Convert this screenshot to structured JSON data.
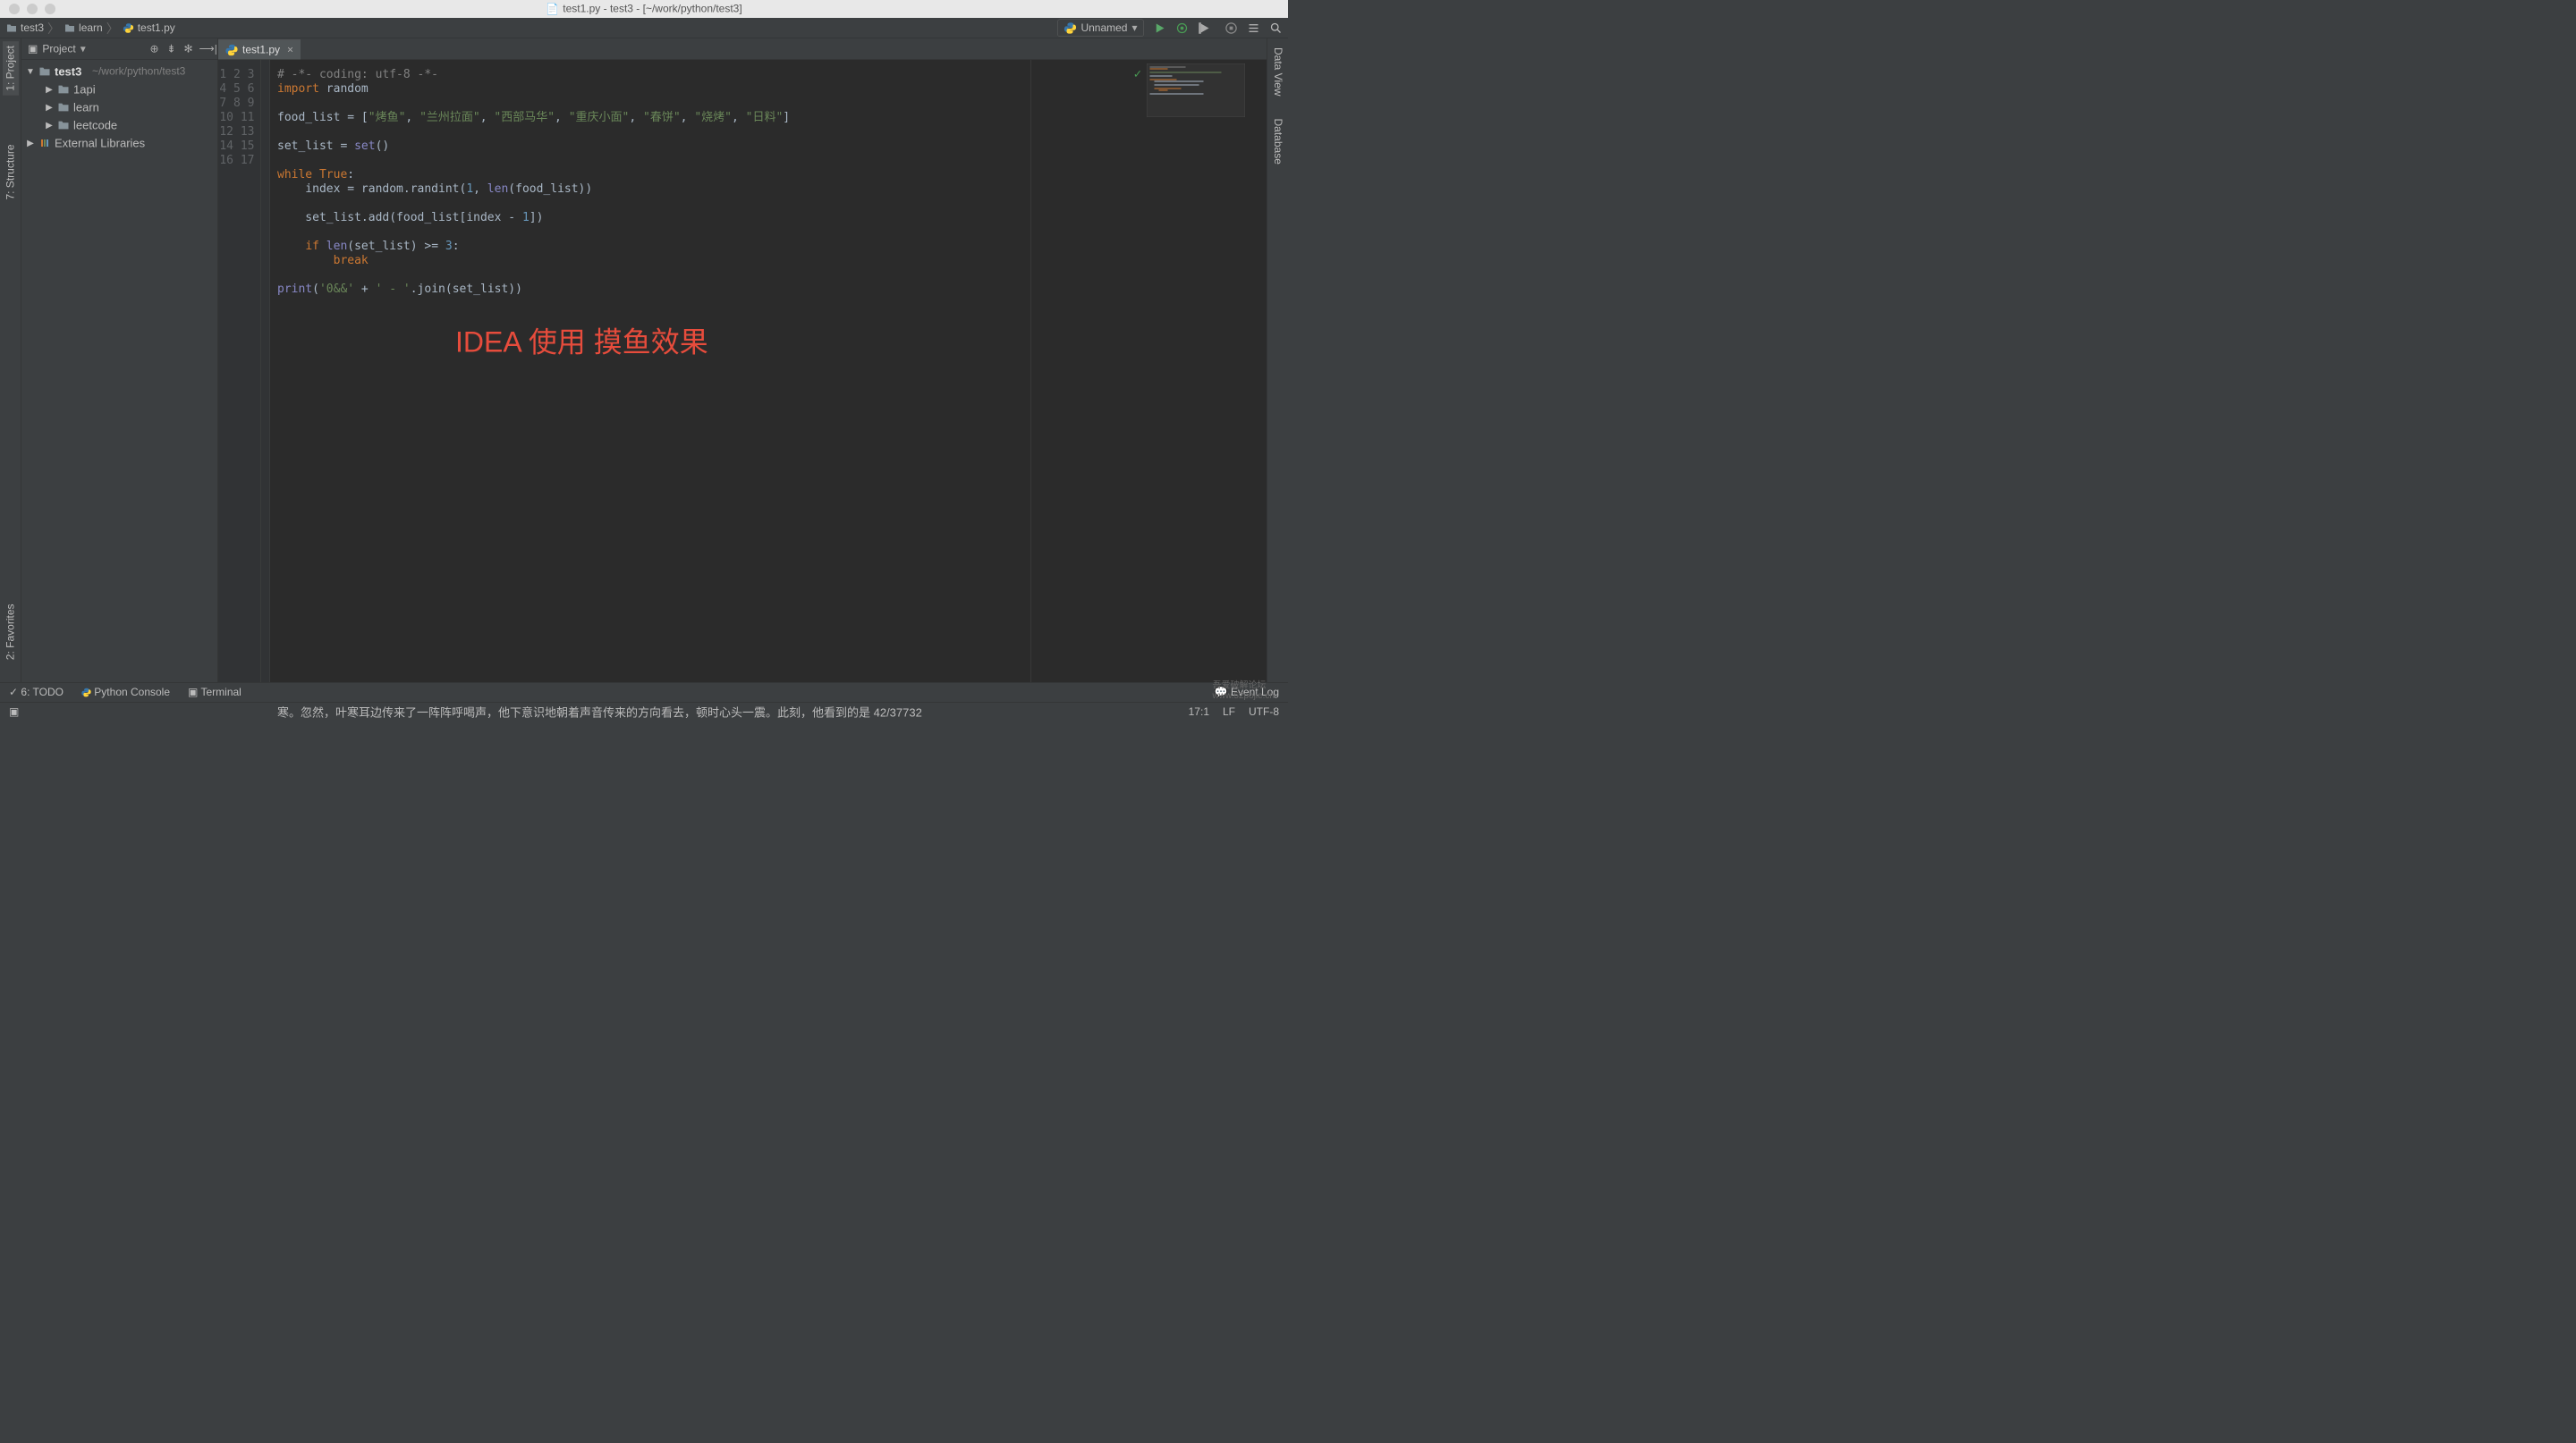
{
  "titlebar": {
    "title": "test1.py - test3 - [~/work/python/test3]"
  },
  "breadcrumbs": [
    {
      "label": "test3",
      "icon": "folder"
    },
    {
      "label": "learn",
      "icon": "folder"
    },
    {
      "label": "test1.py",
      "icon": "python"
    }
  ],
  "run_config": {
    "label": "Unnamed"
  },
  "project_panel": {
    "title": "Project",
    "root": {
      "label": "test3",
      "path": "~/work/python/test3"
    },
    "children": [
      {
        "label": "1api",
        "icon": "folder"
      },
      {
        "label": "learn",
        "icon": "folder"
      },
      {
        "label": "leetcode",
        "icon": "folder"
      }
    ],
    "external": "External Libraries"
  },
  "left_toolwindows": [
    {
      "label": "1: Project"
    },
    {
      "label": "7: Structure"
    },
    {
      "label": "2: Favorites"
    }
  ],
  "right_toolwindows": [
    {
      "label": "Data View"
    },
    {
      "label": "Database"
    }
  ],
  "editor": {
    "tab_label": "test1.py",
    "line_count": 17,
    "overlay": "IDEA 使用 摸鱼效果",
    "code_tokens": [
      [
        [
          "com",
          "# -*- coding: utf-8 -*-"
        ]
      ],
      [
        [
          "kw",
          "import"
        ],
        [
          "id",
          " random"
        ]
      ],
      [],
      [
        [
          "id",
          "food_list = ["
        ],
        [
          "str",
          "\"烤鱼\""
        ],
        [
          "id",
          ", "
        ],
        [
          "str",
          "\"兰州拉面\""
        ],
        [
          "id",
          ", "
        ],
        [
          "str",
          "\"西部马华\""
        ],
        [
          "id",
          ", "
        ],
        [
          "str",
          "\"重庆小面\""
        ],
        [
          "id",
          ", "
        ],
        [
          "str",
          "\"春饼\""
        ],
        [
          "id",
          ", "
        ],
        [
          "str",
          "\"烧烤\""
        ],
        [
          "id",
          ", "
        ],
        [
          "str",
          "\"日料\""
        ],
        [
          "id",
          "]"
        ]
      ],
      [],
      [
        [
          "id",
          "set_list = "
        ],
        [
          "bi",
          "set"
        ],
        [
          "id",
          "()"
        ]
      ],
      [],
      [
        [
          "kw",
          "while "
        ],
        [
          "kw",
          "True"
        ],
        [
          "id",
          ":"
        ]
      ],
      [
        [
          "id",
          "    index = random.randint("
        ],
        [
          "num",
          "1"
        ],
        [
          "id",
          ", "
        ],
        [
          "bi",
          "len"
        ],
        [
          "id",
          "(food_list))"
        ]
      ],
      [],
      [
        [
          "id",
          "    set_list.add(food_list[index - "
        ],
        [
          "num",
          "1"
        ],
        [
          "id",
          "])"
        ]
      ],
      [],
      [
        [
          "id",
          "    "
        ],
        [
          "kw",
          "if "
        ],
        [
          "bi",
          "len"
        ],
        [
          "id",
          "(set_list) >= "
        ],
        [
          "num",
          "3"
        ],
        [
          "id",
          ":"
        ]
      ],
      [
        [
          "id",
          "        "
        ],
        [
          "kw",
          "break"
        ]
      ],
      [],
      [
        [
          "bi",
          "print"
        ],
        [
          "id",
          "("
        ],
        [
          "str",
          "'0&&'"
        ],
        [
          "id",
          " + "
        ],
        [
          "str",
          "' - '"
        ],
        [
          "id",
          ".join(set_list))"
        ]
      ],
      []
    ]
  },
  "bottom_tools": [
    {
      "label": "6: TODO"
    },
    {
      "label": "Python Console"
    },
    {
      "label": "Terminal"
    }
  ],
  "event_log": "Event Log",
  "status_message": "寒。忽然，叶寒耳边传来了一阵阵呼喝声，他下意识地朝着声音传来的方向看去，顿时心头一震。此刻，他看到的是 42/37732",
  "statusbar": {
    "pos": "17:1",
    "line_sep": "LF",
    "encoding": "UTF-8"
  },
  "watermark1": "吾爱破解论坛",
  "watermark2": "www.52pojie.cn"
}
